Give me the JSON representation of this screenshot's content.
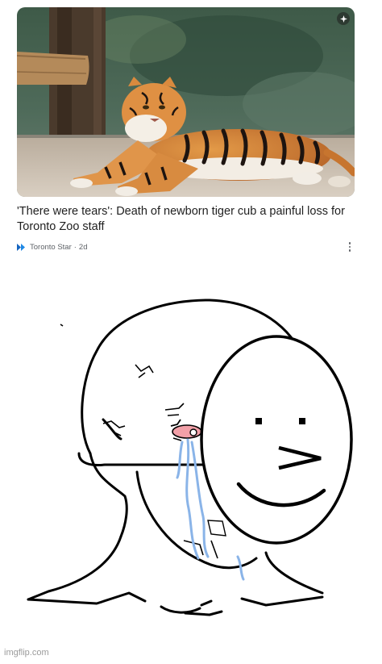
{
  "article": {
    "headline": "'There were tears': Death of newborn tiger cub a painful loss for Toronto Zoo staff",
    "source": "Toronto Star",
    "separator": "·",
    "age": "2d",
    "thumbnail_icon": "spark-icon",
    "menu_icon": "more-vert-icon"
  },
  "meme": {
    "mask_face": ": >",
    "watermark": "imgflip.com"
  },
  "colors": {
    "headline": "#1f1f1f",
    "meta": "#5f6368",
    "source_logo": "#1565c0",
    "tears": "#8ab4e8"
  }
}
